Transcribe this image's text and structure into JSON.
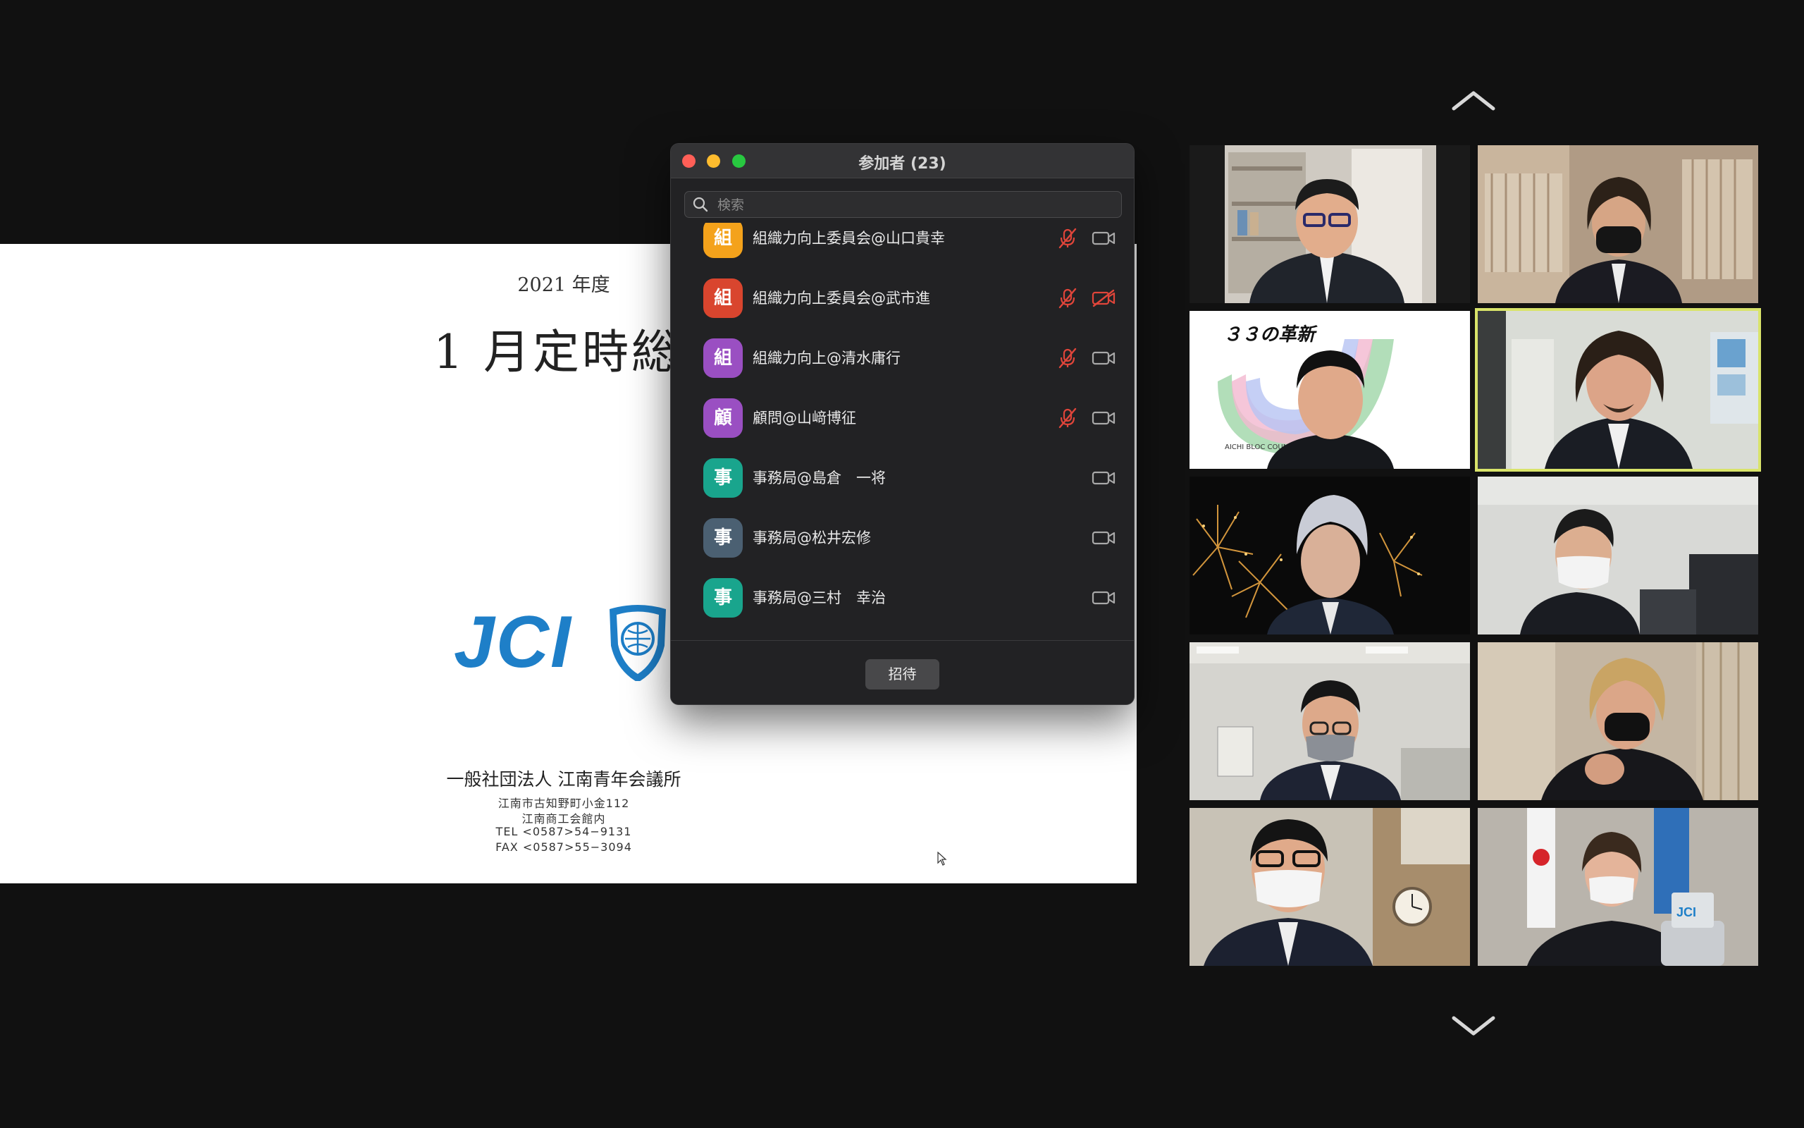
{
  "slide": {
    "year": "2021 年度",
    "title": "1 月定時総",
    "logo_text": "JCI",
    "org_name": "一般社団法人  江南青年会議所",
    "address_1": "江南市古知野町小金112",
    "address_2": "江南商工会館内",
    "tel": "TEL  <0587>54−9131",
    "fax": "FAX  <0587>55−3094"
  },
  "participants_window": {
    "title": "参加者 (23)",
    "search_placeholder": "検索",
    "invite_label": "招待",
    "participants": [
      {
        "initial": "組",
        "name": "組織力向上委員会@山口貴幸",
        "avatar_color": "#f4a21b",
        "muted": true,
        "video_off": false
      },
      {
        "initial": "組",
        "name": "組織力向上委員会@武市進",
        "avatar_color": "#d9452e",
        "muted": true,
        "video_off": true
      },
      {
        "initial": "組",
        "name": "組織力向上@清水庸行",
        "avatar_color": "#9a4fc2",
        "muted": true,
        "video_off": false
      },
      {
        "initial": "顧",
        "name": "顧問@山﨑博征",
        "avatar_color": "#9a4fc2",
        "muted": true,
        "video_off": false
      },
      {
        "initial": "事",
        "name": "事務局@島倉　一将",
        "avatar_color": "#19a58d",
        "muted": false,
        "video_off": false
      },
      {
        "initial": "事",
        "name": "事務局@松井宏修",
        "avatar_color": "#4b6072",
        "muted": false,
        "video_off": false
      },
      {
        "initial": "事",
        "name": "事務局@三村　幸治",
        "avatar_color": "#19a58d",
        "muted": false,
        "video_off": false
      }
    ]
  },
  "gallery": {
    "tiles": [
      {
        "id": "video-tile-1",
        "active": false
      },
      {
        "id": "video-tile-2",
        "active": false
      },
      {
        "id": "video-tile-3",
        "active": false,
        "background_text": "３３の革新",
        "background_subtext": "AICHI BLOC COUNCIL 202"
      },
      {
        "id": "video-tile-4",
        "active": true
      },
      {
        "id": "video-tile-5",
        "active": false
      },
      {
        "id": "video-tile-6",
        "active": false
      },
      {
        "id": "video-tile-7",
        "active": false
      },
      {
        "id": "video-tile-8",
        "active": false
      },
      {
        "id": "video-tile-9",
        "active": false
      },
      {
        "id": "video-tile-10",
        "active": false
      }
    ]
  },
  "colors": {
    "background": "#111111",
    "active_speaker": "#d9e46a",
    "muted_red": "#e0453a",
    "jci_blue": "#1e7fc8"
  },
  "icons": [
    "search-icon",
    "mic-muted-icon",
    "camera-icon",
    "camera-off-icon",
    "chevron-up-icon",
    "chevron-down-icon",
    "cursor-icon"
  ]
}
